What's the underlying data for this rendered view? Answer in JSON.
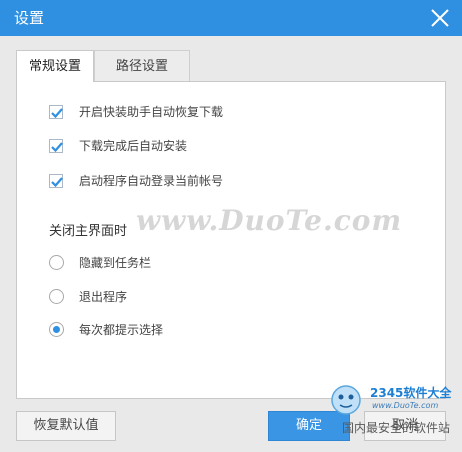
{
  "window": {
    "title": "设置",
    "close_icon": "close-icon"
  },
  "tabs": [
    {
      "label": "常规设置",
      "active": true
    },
    {
      "label": "路径设置",
      "active": false
    }
  ],
  "general": {
    "checkboxes": [
      {
        "label": "开启快装助手自动恢复下载",
        "checked": true
      },
      {
        "label": "下载完成后自动安装",
        "checked": true
      },
      {
        "label": "启动程序自动登录当前帐号",
        "checked": true
      }
    ],
    "close_section_title": "关闭主界面时",
    "radios": [
      {
        "label": "隐藏到任务栏",
        "selected": false
      },
      {
        "label": "退出程序",
        "selected": false
      },
      {
        "label": "每次都提示选择",
        "selected": true
      }
    ]
  },
  "buttons": {
    "restore_label": "恢复默认值",
    "ok_label": "确定",
    "cancel_label": "取消"
  },
  "watermark": "www.DuoTe.com",
  "overlay_logo": {
    "brand": "2345软件大全",
    "url": "www.DuoTe.com",
    "slogan": "国内最安全的软件站"
  },
  "colors": {
    "titlebar": "#2f8fe0",
    "accent": "#2f8fe0",
    "check": "#2f8fe0"
  }
}
